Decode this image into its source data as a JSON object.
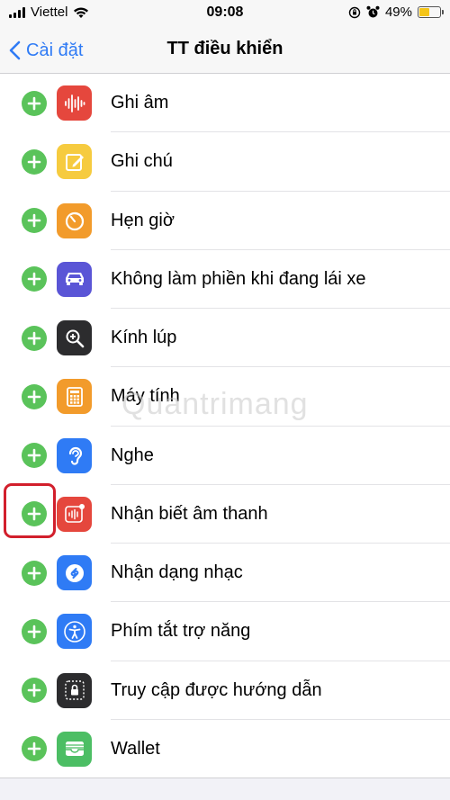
{
  "status_bar": {
    "carrier": "Viettel",
    "time": "09:08",
    "battery_percent": "49%",
    "battery_level": 0.49
  },
  "nav": {
    "back_label": "Cài đặt",
    "title": "TT điều khiển"
  },
  "controls": [
    {
      "label": "Ghi âm",
      "icon": "voice-memos-icon",
      "color": "#e5473d"
    },
    {
      "label": "Ghi chú",
      "icon": "notes-icon",
      "color": "#f6cb3f"
    },
    {
      "label": "Hẹn giờ",
      "icon": "timer-icon",
      "color": "#f29b2b"
    },
    {
      "label": "Không làm phiền khi đang lái xe",
      "icon": "car-icon",
      "color": "#5a55d6"
    },
    {
      "label": "Kính lúp",
      "icon": "magnifier-icon",
      "color": "#2c2c2e"
    },
    {
      "label": "Máy tính",
      "icon": "calculator-icon",
      "color": "#f29b2b"
    },
    {
      "label": "Nghe",
      "icon": "ear-icon",
      "color": "#2f7bf5"
    },
    {
      "label": "Nhận biết âm thanh",
      "icon": "sound-recognition-icon",
      "color": "#e5473d"
    },
    {
      "label": "Nhận dạng nhạc",
      "icon": "shazam-icon",
      "color": "#2f7bf5"
    },
    {
      "label": "Phím tắt trợ năng",
      "icon": "accessibility-icon",
      "color": "#2f7bf5"
    },
    {
      "label": "Truy cập được hướng dẫn",
      "icon": "guided-access-icon",
      "color": "#2c2c2e"
    },
    {
      "label": "Wallet",
      "icon": "wallet-icon",
      "color": "#4cbe64"
    }
  ],
  "watermark": "Quantrimang",
  "colors": {
    "accent": "#2f7bf5",
    "add_button": "#5ac35a",
    "highlight": "#d21f2c"
  }
}
